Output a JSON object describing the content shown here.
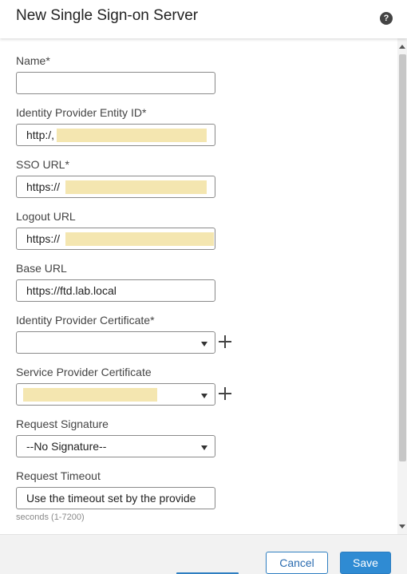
{
  "header": {
    "title": "New Single Sign-on Server",
    "help_icon": "help-icon",
    "help_glyph": "?"
  },
  "form": {
    "name": {
      "label": "Name*",
      "value": ""
    },
    "entity_id": {
      "label": "Identity Provider Entity ID*",
      "value": "http:/,"
    },
    "sso_url": {
      "label": "SSO URL*",
      "value": "https://"
    },
    "logout_url": {
      "label": "Logout URL",
      "value": "https://"
    },
    "base_url": {
      "label": "Base URL",
      "value": "https://ftd.lab.local"
    },
    "idp_certificate": {
      "label": "Identity Provider Certificate*",
      "selected": ""
    },
    "sp_certificate": {
      "label": "Service Provider Certificate",
      "selected": ""
    },
    "request_signature": {
      "label": "Request Signature",
      "selected": "--No Signature--"
    },
    "request_timeout": {
      "label": "Request Timeout",
      "value": "Use the timeout set by the provide",
      "hint": "seconds (1-7200)"
    }
  },
  "footer": {
    "cancel_label": "Cancel",
    "save_label": "Save"
  },
  "colors": {
    "accent": "#2f8bd3",
    "redaction": "#f4e6b0"
  }
}
